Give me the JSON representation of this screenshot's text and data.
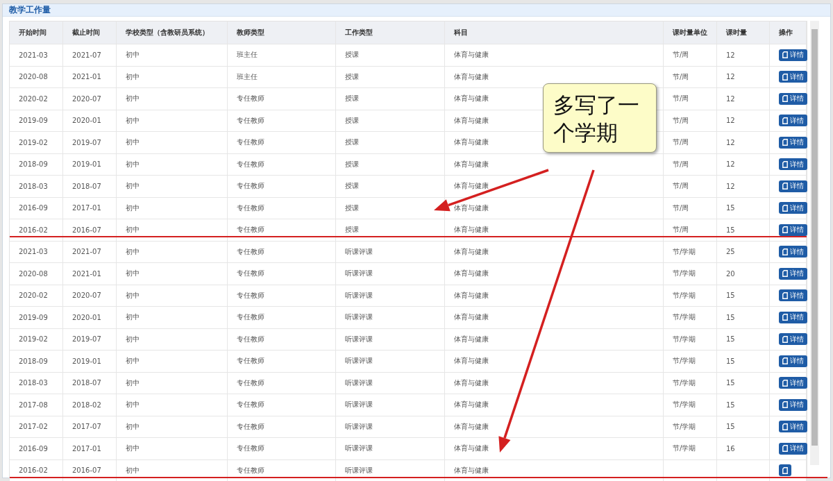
{
  "panel": {
    "title": "教学工作量"
  },
  "table": {
    "columns": [
      "开始时间",
      "截止时间",
      "学校类型（含教研员系统）",
      "教师类型",
      "工作类型",
      "科目",
      "课时量单位",
      "课时量",
      "操作"
    ],
    "rows": [
      {
        "cells": [
          "2021-03",
          "2021-07",
          "初中",
          "班主任",
          "授课",
          "体育与健康",
          "节/周",
          "12"
        ],
        "action": "详情",
        "struck": false
      },
      {
        "cells": [
          "2020-08",
          "2021-01",
          "初中",
          "班主任",
          "授课",
          "体育与健康",
          "节/周",
          "12"
        ],
        "action": "详情",
        "struck": false
      },
      {
        "cells": [
          "2020-02",
          "2020-07",
          "初中",
          "专任教师",
          "授课",
          "体育与健康",
          "节/周",
          "12"
        ],
        "action": "详情",
        "struck": false
      },
      {
        "cells": [
          "2019-09",
          "2020-01",
          "初中",
          "专任教师",
          "授课",
          "体育与健康",
          "节/周",
          "12"
        ],
        "action": "详情",
        "struck": false
      },
      {
        "cells": [
          "2019-02",
          "2019-07",
          "初中",
          "专任教师",
          "授课",
          "体育与健康",
          "节/周",
          "12"
        ],
        "action": "详情",
        "struck": false
      },
      {
        "cells": [
          "2018-09",
          "2019-01",
          "初中",
          "专任教师",
          "授课",
          "体育与健康",
          "节/周",
          "12"
        ],
        "action": "详情",
        "struck": false
      },
      {
        "cells": [
          "2018-03",
          "2018-07",
          "初中",
          "专任教师",
          "授课",
          "体育与健康",
          "节/周",
          "12"
        ],
        "action": "详情",
        "struck": false
      },
      {
        "cells": [
          "2016-09",
          "2017-01",
          "初中",
          "专任教师",
          "授课",
          "体育与健康",
          "节/周",
          "15"
        ],
        "action": "详情",
        "struck": false
      },
      {
        "cells": [
          "2016-02",
          "2016-07",
          "初中",
          "专任教师",
          "授课",
          "体育与健康",
          "节/周",
          "15"
        ],
        "action": "详情",
        "struck": true
      },
      {
        "cells": [
          "2021-03",
          "2021-07",
          "初中",
          "专任教师",
          "听课评课",
          "体育与健康",
          "节/学期",
          "25"
        ],
        "action": "详情",
        "struck": false
      },
      {
        "cells": [
          "2020-08",
          "2021-01",
          "初中",
          "专任教师",
          "听课评课",
          "体育与健康",
          "节/学期",
          "20"
        ],
        "action": "详情",
        "struck": false
      },
      {
        "cells": [
          "2020-02",
          "2020-07",
          "初中",
          "专任教师",
          "听课评课",
          "体育与健康",
          "节/学期",
          "15"
        ],
        "action": "详情",
        "struck": false
      },
      {
        "cells": [
          "2019-09",
          "2020-01",
          "初中",
          "专任教师",
          "听课评课",
          "体育与健康",
          "节/学期",
          "15"
        ],
        "action": "详情",
        "struck": false
      },
      {
        "cells": [
          "2019-02",
          "2019-07",
          "初中",
          "专任教师",
          "听课评课",
          "体育与健康",
          "节/学期",
          "15"
        ],
        "action": "详情",
        "struck": false
      },
      {
        "cells": [
          "2018-09",
          "2019-01",
          "初中",
          "专任教师",
          "听课评课",
          "体育与健康",
          "节/学期",
          "15"
        ],
        "action": "详情",
        "struck": false
      },
      {
        "cells": [
          "2018-03",
          "2018-07",
          "初中",
          "专任教师",
          "听课评课",
          "体育与健康",
          "节/学期",
          "15"
        ],
        "action": "详情",
        "struck": false
      },
      {
        "cells": [
          "2017-08",
          "2018-02",
          "初中",
          "专任教师",
          "听课评课",
          "体育与健康",
          "节/学期",
          "15"
        ],
        "action": "详情",
        "struck": false
      },
      {
        "cells": [
          "2017-02",
          "2017-07",
          "初中",
          "专任教师",
          "听课评课",
          "体育与健康",
          "节/学期",
          "15"
        ],
        "action": "详情",
        "struck": false
      },
      {
        "cells": [
          "2016-09",
          "2017-01",
          "初中",
          "专任教师",
          "听课评课",
          "体育与健康",
          "节/学期",
          "16"
        ],
        "action": "详情",
        "struck": false
      },
      {
        "cells": [
          "2016-02",
          "2016-07",
          "初中",
          "专任教师",
          "听课评课",
          "体育与健康"
        ],
        "struck": true
      }
    ]
  },
  "callout": {
    "text": "多写了一个学期"
  }
}
